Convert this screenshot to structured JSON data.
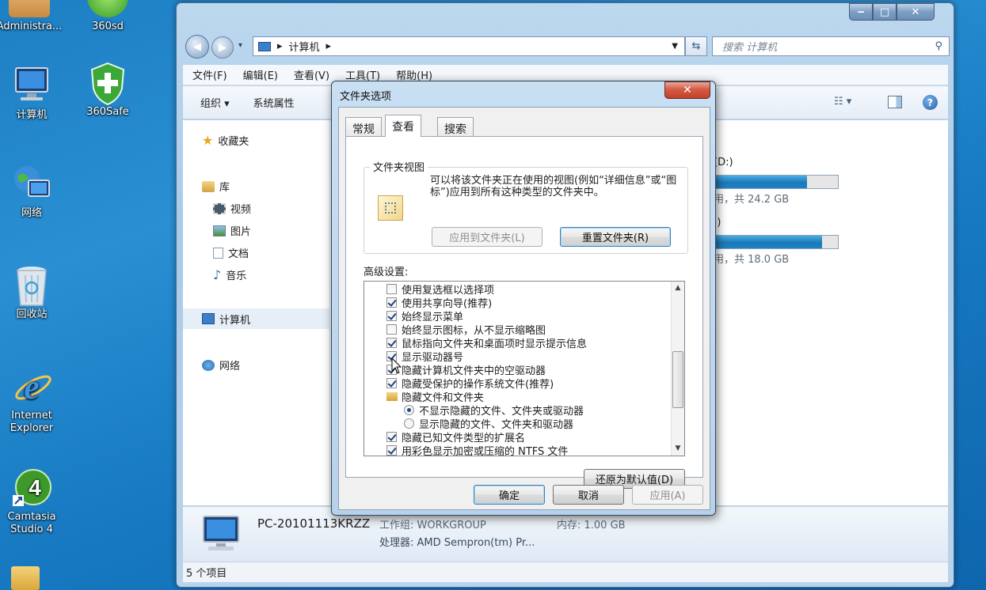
{
  "desktop": {
    "icons": [
      {
        "label": "Administra...",
        "icon": "user-icon"
      },
      {
        "label": "360sd",
        "icon": "360sd-icon"
      },
      {
        "label": "计算机",
        "icon": "computer-icon"
      },
      {
        "label": "360Safe",
        "icon": "shield-icon"
      },
      {
        "label": "网络",
        "icon": "network-icon"
      },
      {
        "label": "回收站",
        "icon": "recycle-bin-icon"
      },
      {
        "label": "Internet Explorer",
        "icon": "ie-icon"
      },
      {
        "label": "Camtasia Studio 4",
        "icon": "camtasia-icon"
      }
    ]
  },
  "explorer": {
    "address": {
      "location": "计算机"
    },
    "search_placeholder": "搜索 计算机",
    "menu": [
      "文件(F)",
      "编辑(E)",
      "查看(V)",
      "工具(T)",
      "帮助(H)"
    ],
    "toolbar": {
      "organize": "组织 ▾",
      "system_props": "系统属性"
    },
    "nav": {
      "favorites": "收藏夹",
      "libraries": "库",
      "videos": "视频",
      "pictures": "图片",
      "documents": "文档",
      "music": "音乐",
      "computer": "计算机",
      "network": "网络"
    },
    "drives": [
      {
        "label": "(D:)",
        "usage": "用，共 24.2 GB",
        "fill_pct": 75
      },
      {
        "label": ":)",
        "usage": "用，共 18.0 GB",
        "fill_pct": 87
      }
    ],
    "details": {
      "pc_name": "PC-20101113KRZZ",
      "workgroup": "工作组: WORKGROUP",
      "memory": "内存: 1.00 GB",
      "processor": "处理器: AMD Sempron(tm) Pr..."
    },
    "status": "5 个项目"
  },
  "dialog": {
    "title": "文件夹选项",
    "close": "✕",
    "tabs": [
      "常规",
      "查看",
      "搜索"
    ],
    "active_tab": "查看",
    "folder_views": {
      "group_label": "文件夹视图",
      "desc": "可以将该文件夹正在使用的视图(例如“详细信息”或“图标”)应用到所有这种类型的文件夹中。",
      "apply_btn": "应用到文件夹(L)",
      "reset_btn": "重置文件夹(R)"
    },
    "advanced_label": "高级设置:",
    "settings": [
      {
        "type": "check",
        "checked": false,
        "label": "使用复选框以选择项"
      },
      {
        "type": "check",
        "checked": true,
        "label": "使用共享向导(推荐)"
      },
      {
        "type": "check",
        "checked": true,
        "label": "始终显示菜单"
      },
      {
        "type": "check",
        "checked": false,
        "label": "始终显示图标，从不显示缩略图"
      },
      {
        "type": "check",
        "checked": true,
        "label": "鼠标指向文件夹和桌面项时显示提示信息"
      },
      {
        "type": "check",
        "checked": true,
        "label": "显示驱动器号"
      },
      {
        "type": "check",
        "checked": true,
        "label": "隐藏计算机文件夹中的空驱动器"
      },
      {
        "type": "check",
        "checked": true,
        "label": "隐藏受保护的操作系统文件(推荐)"
      },
      {
        "type": "folder",
        "label": "隐藏文件和文件夹"
      },
      {
        "type": "radio",
        "checked": true,
        "label": "不显示隐藏的文件、文件夹或驱动器"
      },
      {
        "type": "radio",
        "checked": false,
        "label": "显示隐藏的文件、文件夹和驱动器"
      },
      {
        "type": "check",
        "checked": true,
        "label": "隐藏已知文件类型的扩展名"
      },
      {
        "type": "check",
        "checked": true,
        "label": "用彩色显示加密或压缩的 NTFS 文件"
      }
    ],
    "restore_btn": "还原为默认值(D)",
    "ok": "确定",
    "cancel": "取消",
    "apply": "应用(A)"
  }
}
